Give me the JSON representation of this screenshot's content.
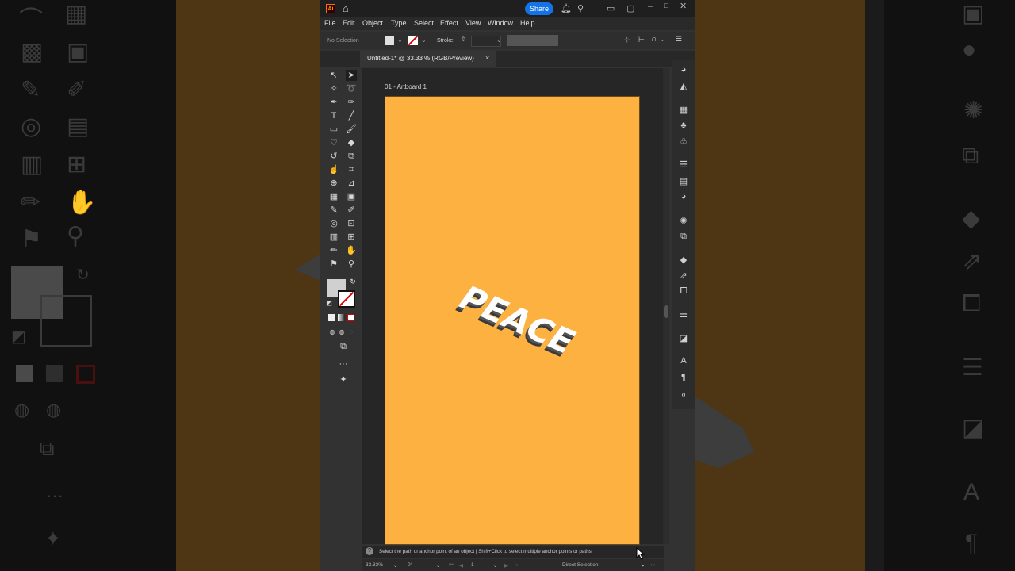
{
  "app": {
    "logo": "Ai",
    "share_label": "Share",
    "menu": [
      "File",
      "Edit",
      "Object",
      "Type",
      "Select",
      "Effect",
      "View",
      "Window",
      "Help"
    ]
  },
  "control_bar": {
    "selection": "No Selection",
    "stroke_label": "Stroke:"
  },
  "document": {
    "tab_title": "Untitled-1* @ 33.33 % (RGB/Preview)",
    "close_glyph": "×",
    "artboard_name": "01 - Artboard 1",
    "artboard_color": "#fdb140"
  },
  "artwork": {
    "text": "PEACE",
    "face_color": "#ffffff",
    "extrude_color": "#3a3a3a"
  },
  "status": {
    "hint": "Select the path or anchor point of an object  |  Shift+Click to select multiple anchor points or paths",
    "zoom": "33.33%",
    "rotation": "0°",
    "artboard_number": "1",
    "tool_name": "Direct Selection"
  },
  "icons": {
    "home": "home-icon",
    "notifications": "bell-icon",
    "search": "search-icon",
    "arrange": "arrange-icon",
    "minimize": "minimize-icon",
    "maximize": "maximize-icon",
    "close": "close-icon"
  },
  "toolbar_icons": [
    "selection-tool-icon",
    "direct-selection-tool-icon",
    "magic-wand-icon",
    "lasso-icon",
    "pen-tool-icon",
    "curvature-icon",
    "type-tool-icon",
    "line-tool-icon",
    "rectangle-tool-icon",
    "paintbrush-icon",
    "shaper-icon",
    "eraser-icon",
    "rotate-icon",
    "scale-icon",
    "warp-icon",
    "free-transform-icon",
    "shape-builder-icon",
    "perspective-icon",
    "mesh-icon",
    "gradient-icon",
    "eyedropper-icon",
    "blend-icon",
    "symbol-sprayer-icon",
    "artboard-tool-icon",
    "graph-icon",
    "slice-icon",
    "pencil-icon",
    "hand-icon",
    "chart-icon",
    "zoom-icon"
  ]
}
